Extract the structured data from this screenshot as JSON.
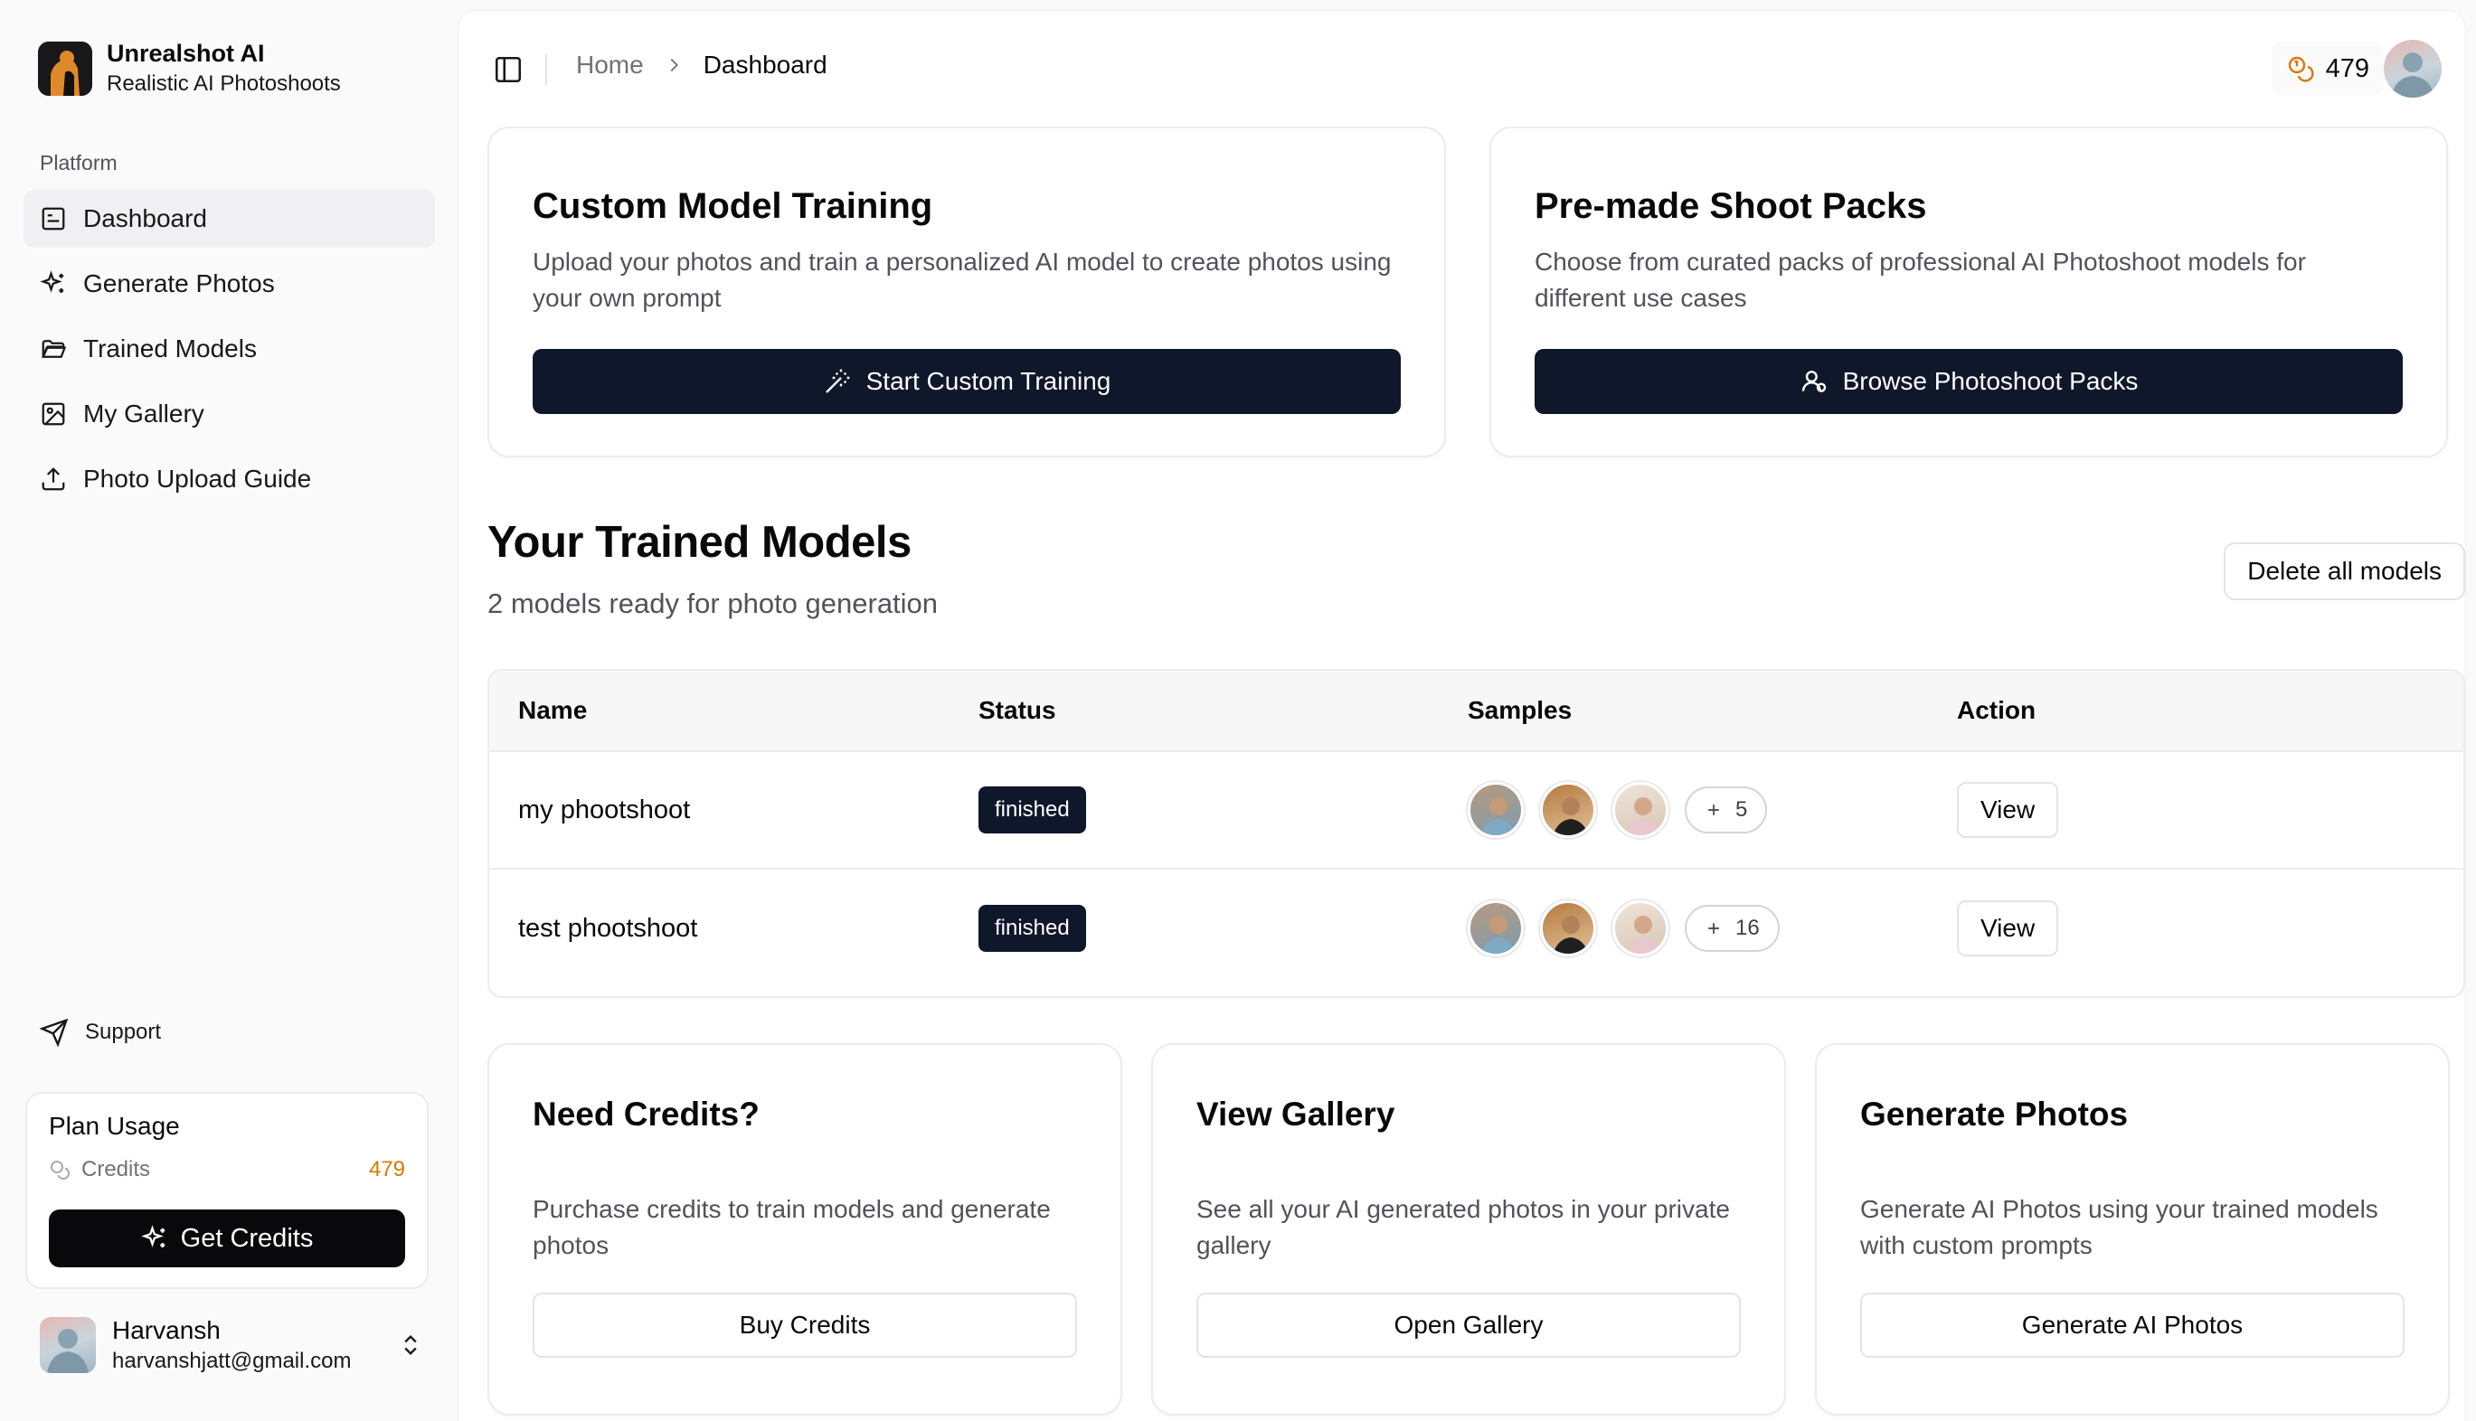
{
  "brand": {
    "name": "Unrealshot AI",
    "tagline": "Realistic AI Photoshoots"
  },
  "sidebar": {
    "group_label": "Platform",
    "items": [
      {
        "label": "Dashboard",
        "icon": "dashboard-icon",
        "active": true
      },
      {
        "label": "Generate Photos",
        "icon": "sparkles-icon"
      },
      {
        "label": "Trained Models",
        "icon": "folder-open-icon"
      },
      {
        "label": "My Gallery",
        "icon": "image-icon"
      },
      {
        "label": "Photo Upload Guide",
        "icon": "upload-icon"
      }
    ],
    "support_label": "Support",
    "plan": {
      "title": "Plan Usage",
      "credits_label": "Credits",
      "credits_value": "479",
      "cta": "Get Credits"
    },
    "user": {
      "name": "Harvansh",
      "email": "harvanshjatt@gmail.com"
    }
  },
  "header": {
    "breadcrumb": [
      "Home",
      "Dashboard"
    ],
    "credits": "479"
  },
  "cards_top": [
    {
      "title": "Custom Model Training",
      "description": "Upload your photos and train a personalized AI model to create photos using your own prompt",
      "button": "Start Custom Training"
    },
    {
      "title": "Pre-made Shoot Packs",
      "description": "Choose from curated packs of professional AI Photoshoot models for different use cases",
      "button": "Browse Photoshoot Packs"
    }
  ],
  "models": {
    "title": "Your Trained Models",
    "subtitle": "2 models ready for photo generation",
    "delete_label": "Delete all models",
    "columns": [
      "Name",
      "Status",
      "Samples",
      "Action"
    ],
    "rows": [
      {
        "name": "my phootshoot",
        "status": "finished",
        "more": "5",
        "action": "View"
      },
      {
        "name": "test phootshoot",
        "status": "finished",
        "more": "16",
        "action": "View"
      }
    ]
  },
  "cards_bottom": [
    {
      "title": "Need Credits?",
      "description": "Purchase credits to train models and generate photos",
      "button": "Buy Credits"
    },
    {
      "title": "View Gallery",
      "description": "See all your AI generated photos in your private gallery",
      "button": "Open Gallery"
    },
    {
      "title": "Generate Photos",
      "description": "Generate AI Photos using your trained models with custom prompts",
      "button": "Generate AI Photos"
    }
  ],
  "colors": {
    "dark": "#0f172a",
    "accent_credit": "#d97706",
    "muted": "#52525b"
  }
}
